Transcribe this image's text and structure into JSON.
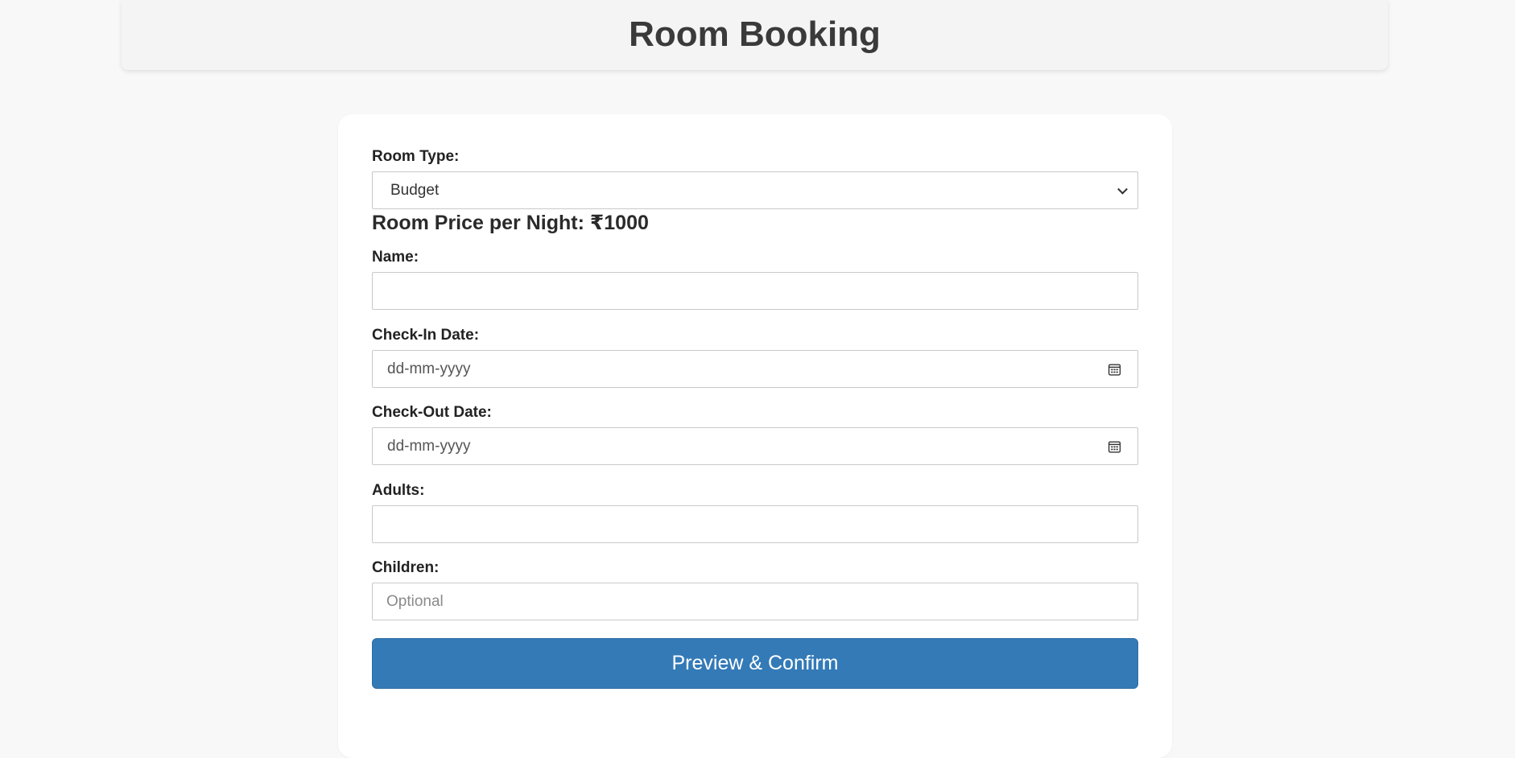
{
  "header": {
    "title": "Room Booking"
  },
  "form": {
    "room_type": {
      "label": "Room Type:",
      "selected": "Budget"
    },
    "price": {
      "text": "Room Price per Night: ₹1000"
    },
    "name": {
      "label": "Name:",
      "value": "",
      "placeholder": ""
    },
    "check_in": {
      "label": "Check-In Date:",
      "placeholder": "dd-mm-yyyy"
    },
    "check_out": {
      "label": "Check-Out Date:",
      "placeholder": "dd-mm-yyyy"
    },
    "adults": {
      "label": "Adults:",
      "value": "",
      "placeholder": ""
    },
    "children": {
      "label": "Children:",
      "value": "",
      "placeholder": "Optional"
    },
    "submit_label": "Preview & Confirm"
  },
  "colors": {
    "button": "#337ab7",
    "page_bg": "#f8f8f8",
    "header_bg": "#f4f4f4",
    "card_bg": "#ffffff"
  },
  "icons": {
    "select_arrow": "chevron-down-icon",
    "date_picker": "calendar-icon"
  }
}
